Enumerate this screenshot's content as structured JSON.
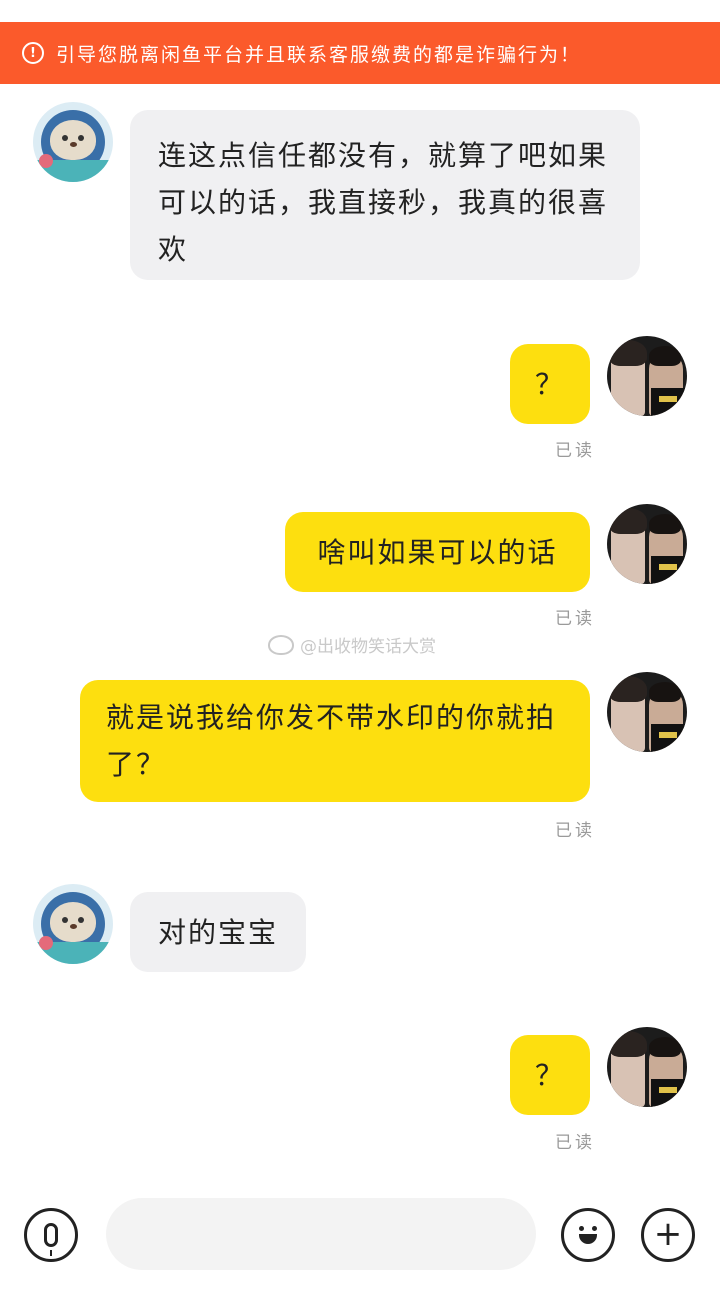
{
  "banner": {
    "icon": "alert-circle-icon",
    "icon_glyph": "!",
    "text": "引导您脱离闲鱼平台并且联系客服缴费的都是诈骗行为！",
    "color": "#fb5a2b"
  },
  "messages": [
    {
      "side": "in",
      "text": "连这点信任都没有，就算了吧如果可以的话，我直接秒，我真的很喜欢"
    },
    {
      "side": "out",
      "text": "？",
      "status": "已读"
    },
    {
      "side": "out",
      "text": "啥叫如果可以的话",
      "status": "已读"
    },
    {
      "side": "out",
      "text": "就是说我给你发不带水印的你就拍了？",
      "status": "已读"
    },
    {
      "side": "in",
      "text": "对的宝宝"
    },
    {
      "side": "out",
      "text": "？",
      "status": "已读"
    }
  ],
  "watermark": {
    "text": "@出收物笑话大赏",
    "icon": "weibo-icon"
  },
  "input_bar": {
    "voice_icon": "microphone-icon",
    "input_value": "",
    "emoji_icon": "smiley-icon",
    "plus_icon": "plus-icon",
    "plus_glyph": "+"
  },
  "colors": {
    "outgoing_bubble": "#fddf0f",
    "incoming_bubble": "#f0f0f2"
  }
}
